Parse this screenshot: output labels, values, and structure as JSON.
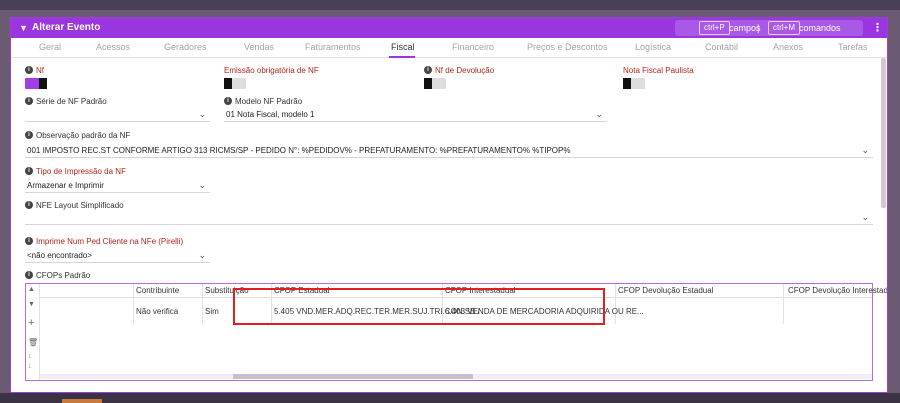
{
  "window": {
    "title": "Alterar Evento",
    "shortcuts": [
      {
        "key": "ctrl+P",
        "text": "campos"
      },
      {
        "key": "ctrl+M",
        "text": "comandos"
      }
    ],
    "separator": "|",
    "menu_glyph": "⋮"
  },
  "tabs": [
    "Geral",
    "Acessos",
    "Geradores",
    "Vendas",
    "Faturamentos",
    "Fiscal",
    "Financeiro",
    "Preços e Descontos",
    "Logística",
    "Contábil",
    "Anexos",
    "Tarefas"
  ],
  "active_tab": "Fiscal",
  "fields": {
    "nf": {
      "label": "Nf",
      "state": "on"
    },
    "emissao": {
      "label": "Emissão obrigatória de NF",
      "state": "off"
    },
    "nf_devolucao": {
      "label": "Nf de Devolução",
      "state": "off"
    },
    "nota_paulista": {
      "label": "Nota Fiscal Paulista",
      "state": "off"
    },
    "serie_nf": {
      "label": "Série de NF Padrão",
      "value": ""
    },
    "modelo_nf": {
      "label": "Modelo NF Padrão",
      "value": "01 Nota Fiscal, modelo 1"
    },
    "observacao": {
      "label": "Observação padrão da NF",
      "value": "001 IMPOSTO REC.ST CONFORME ARTIGO 313 RICMS/SP - PEDIDO N°: %PEDIDOV% - PREFATURAMENTO: %PREFATURAMENTO% %TIPOP%"
    },
    "tipo_impressao": {
      "label": "Tipo de Impressão da NF",
      "value": "Armazenar e Imprimir"
    },
    "nfe_layout": {
      "label": "NFE Layout Simplificado",
      "value": ""
    },
    "imprime_num": {
      "label": "Imprime Num Ped Cliente na NFe (Pirelli)",
      "value": "<não encontrado>"
    },
    "cfops_label": "CFOPs Padrão"
  },
  "grid": {
    "columns": [
      "Contribuinte",
      "Substituição",
      "CFOP Estadual",
      "CFOP Interestadual",
      "CFOP Devolução Estadual",
      "CFOP Devolução Interestadual"
    ],
    "rows": [
      [
        "Não verifica",
        "Sim",
        "5.405 VND.MER.ADQ.REC.TER.MER.SUJ.TRI.CON.SB /",
        "6.403 VENDA DE MERCADORIA ADQUIRIDA OU RE...",
        "",
        ""
      ]
    ],
    "tools": [
      "▲",
      "▼",
      "+",
      "🗑",
      "1",
      "1"
    ]
  },
  "colors": {
    "accent": "#9b35e0",
    "highlight": "#e02020",
    "required_label": "#b1261c"
  }
}
